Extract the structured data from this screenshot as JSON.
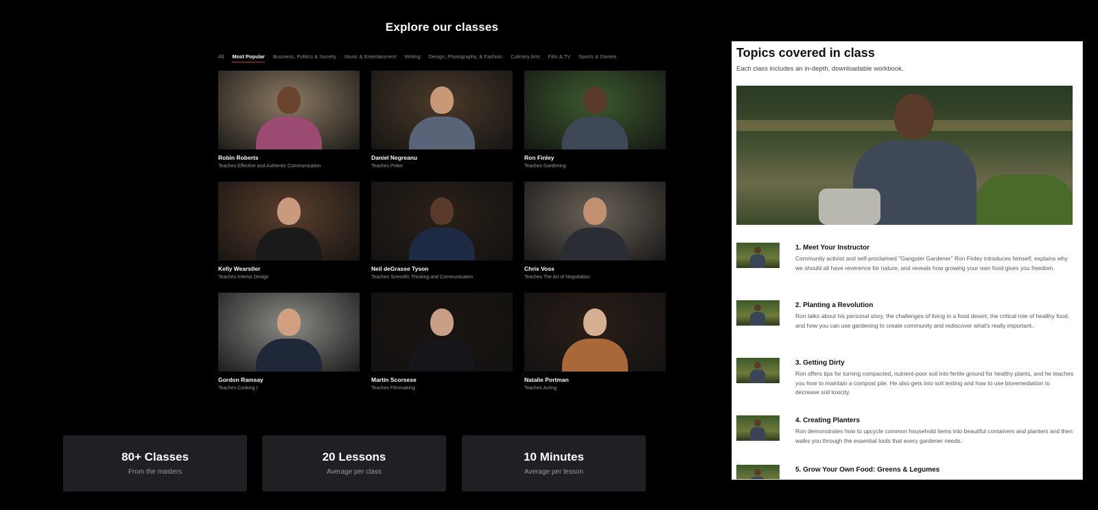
{
  "page": {
    "title": "Explore our classes"
  },
  "tabs": [
    {
      "label": "All",
      "active": false
    },
    {
      "label": "Most Popular",
      "active": true
    },
    {
      "label": "Business, Politics & Society",
      "active": false
    },
    {
      "label": "Music & Entertainment",
      "active": false
    },
    {
      "label": "Writing",
      "active": false
    },
    {
      "label": "Design, Photography, & Fashion",
      "active": false
    },
    {
      "label": "Culinary Arts",
      "active": false
    },
    {
      "label": "Film & TV",
      "active": false
    },
    {
      "label": "Sports & Games",
      "active": false
    }
  ],
  "classes": [
    {
      "name": "Robin Roberts",
      "subtitle": "Teaches Effective and Authentic Communication",
      "bg": "#8b7a62",
      "skin": "#6b4430",
      "shirt": "#9b4a72"
    },
    {
      "name": "Daniel Negreanu",
      "subtitle": "Teaches Poker",
      "bg": "#4a3a2a",
      "skin": "#c99878",
      "shirt": "#5a6478"
    },
    {
      "name": "Ron Finley",
      "subtitle": "Teaches Gardening",
      "bg": "#3c5a2e",
      "skin": "#5a3a28",
      "shirt": "#3e4856"
    },
    {
      "name": "Kelly Wearstler",
      "subtitle": "Teaches Interior Design",
      "bg": "#5a3e2c",
      "skin": "#c89a7e",
      "shirt": "#1a1a1a"
    },
    {
      "name": "Neil deGrasse Tyson",
      "subtitle": "Teaches Scientific Thinking and Communication",
      "bg": "#2a2018",
      "skin": "#5a3a28",
      "shirt": "#1e2a44"
    },
    {
      "name": "Chris Voss",
      "subtitle": "Teaches The Art of Negotiation",
      "bg": "#6a6258",
      "skin": "#c09070",
      "shirt": "#2a2e34"
    },
    {
      "name": "Gordon Ramsay",
      "subtitle": "Teaches Cooking I",
      "bg": "#8a8a86",
      "skin": "#d0a080",
      "shirt": "#1e2838"
    },
    {
      "name": "Martin Scorsese",
      "subtitle": "Teaches Filmmaking",
      "bg": "#1a1410",
      "skin": "#c8a088",
      "shirt": "#16161a"
    },
    {
      "name": "Natalie Portman",
      "subtitle": "Teaches Acting",
      "bg": "#2a1e18",
      "skin": "#d6ae90",
      "shirt": "#a8683a"
    }
  ],
  "stats": [
    {
      "value": "80+ Classes",
      "label": "From the masters"
    },
    {
      "value": "20 Lessons",
      "label": "Average per class"
    },
    {
      "value": "10 Minutes",
      "label": "Average per lesson"
    }
  ],
  "panel": {
    "title": "Topics covered in class",
    "subtitle": "Each class includes an in-depth, downloadable workbook.",
    "lessons": [
      {
        "title": "1. Meet Your Instructor",
        "desc": "Community activist and self-proclaimed \"Gangster Gardener\" Ron Finley introduces himself, explains why we should all have reverence for nature, and reveals how growing your own food gives you freedom."
      },
      {
        "title": "2. Planting a Revolution",
        "desc": "Ron talks about his personal story, the challenges of living in a food desert, the critical role of healthy food, and how you can use gardening to create community and rediscover what's really important."
      },
      {
        "title": "3. Getting Dirty",
        "desc": "Ron offers tips for turning compacted, nutrient-poor soil into fertile ground for healthy plants, and he teaches you how to maintain a compost pile. He also gets into soil testing and how to use bioremediation to decrease soil toxicity."
      },
      {
        "title": "4. Creating Planters",
        "desc": "Ron demonstrates how to upcycle common household items into beautiful containers and planters and then walks you through the essential tools that every gardener needs."
      },
      {
        "title": "5. Grow Your Own Food: Greens & Legumes",
        "desc": ""
      }
    ]
  }
}
